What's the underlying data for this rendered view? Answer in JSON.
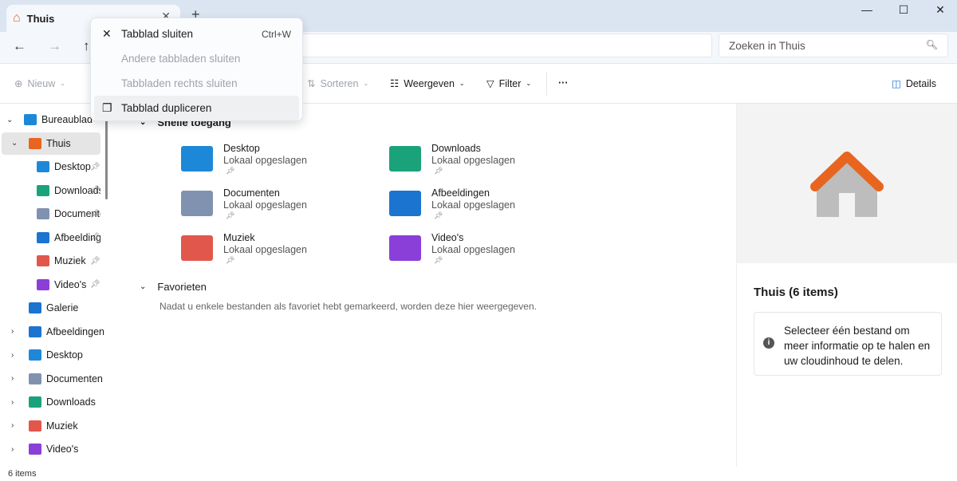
{
  "tab": {
    "title": "Thuis",
    "icon": "home-icon"
  },
  "address": {
    "search_placeholder": "Zoeken in Thuis"
  },
  "toolbar": {
    "new": "Nieuw",
    "sort": "Sorteren",
    "view": "Weergeven",
    "filter": "Filter",
    "more": "···",
    "details": "Details"
  },
  "context_menu": [
    {
      "label": "Tabblad sluiten",
      "shortcut": "Ctrl+W",
      "enabled": true,
      "icon": "close-icon"
    },
    {
      "label": "Andere tabbladen sluiten",
      "enabled": false
    },
    {
      "label": "Tabbladen rechts sluiten",
      "enabled": false
    },
    {
      "label": "Tabblad dupliceren",
      "enabled": true,
      "icon": "duplicate-icon"
    }
  ],
  "sidebar": [
    {
      "label": "Bureaublad",
      "level": 0,
      "chevron": "down",
      "color": "#1e88d8"
    },
    {
      "label": "Thuis",
      "level": 1,
      "chevron": "down",
      "color": "#e8651f",
      "selected": true
    },
    {
      "label": "Desktop",
      "level": 2,
      "pinned": true,
      "color": "#1e88d8"
    },
    {
      "label": "Downloads",
      "level": 2,
      "pinned": true,
      "color": "#1aa37a"
    },
    {
      "label": "Documenten",
      "level": 2,
      "pinned": true,
      "color": "#8192b0"
    },
    {
      "label": "Afbeeldingen",
      "level": 2,
      "pinned": true,
      "color": "#1b74d0"
    },
    {
      "label": "Muziek",
      "level": 2,
      "pinned": true,
      "color": "#e2574c"
    },
    {
      "label": "Video's",
      "level": 2,
      "pinned": true,
      "color": "#8b3fd9"
    },
    {
      "label": "Galerie",
      "level": 1,
      "color": "#1b74d0"
    },
    {
      "label": "Afbeeldingen",
      "level": 1,
      "chevron": "right",
      "color": "#1b74d0"
    },
    {
      "label": "Desktop",
      "level": 1,
      "chevron": "right",
      "color": "#1e88d8"
    },
    {
      "label": "Documenten",
      "level": 1,
      "chevron": "right",
      "color": "#8192b0"
    },
    {
      "label": "Downloads",
      "level": 1,
      "chevron": "right",
      "color": "#1aa37a"
    },
    {
      "label": "Muziek",
      "level": 1,
      "chevron": "right",
      "color": "#e2574c"
    },
    {
      "label": "Video's",
      "level": 1,
      "chevron": "right",
      "color": "#8b3fd9"
    }
  ],
  "quick_access": {
    "title": "Snelle toegang",
    "items": [
      {
        "name": "Desktop",
        "sub": "Lokaal opgeslagen",
        "color": "#1e88d8"
      },
      {
        "name": "Downloads",
        "sub": "Lokaal opgeslagen",
        "color": "#1aa37a"
      },
      {
        "name": "Documenten",
        "sub": "Lokaal opgeslagen",
        "color": "#8192b0"
      },
      {
        "name": "Afbeeldingen",
        "sub": "Lokaal opgeslagen",
        "color": "#1b74d0"
      },
      {
        "name": "Muziek",
        "sub": "Lokaal opgeslagen",
        "color": "#e2574c"
      },
      {
        "name": "Video's",
        "sub": "Lokaal opgeslagen",
        "color": "#8b3fd9"
      }
    ]
  },
  "favorites": {
    "title": "Favorieten",
    "empty": "Nadat u enkele bestanden als favoriet hebt gemarkeerd, worden deze hier weergegeven."
  },
  "details": {
    "title": "Thuis (6 items)",
    "info": "Selecteer één bestand om meer informatie op te halen en uw cloudinhoud te delen."
  },
  "status": {
    "count": "6 items"
  }
}
